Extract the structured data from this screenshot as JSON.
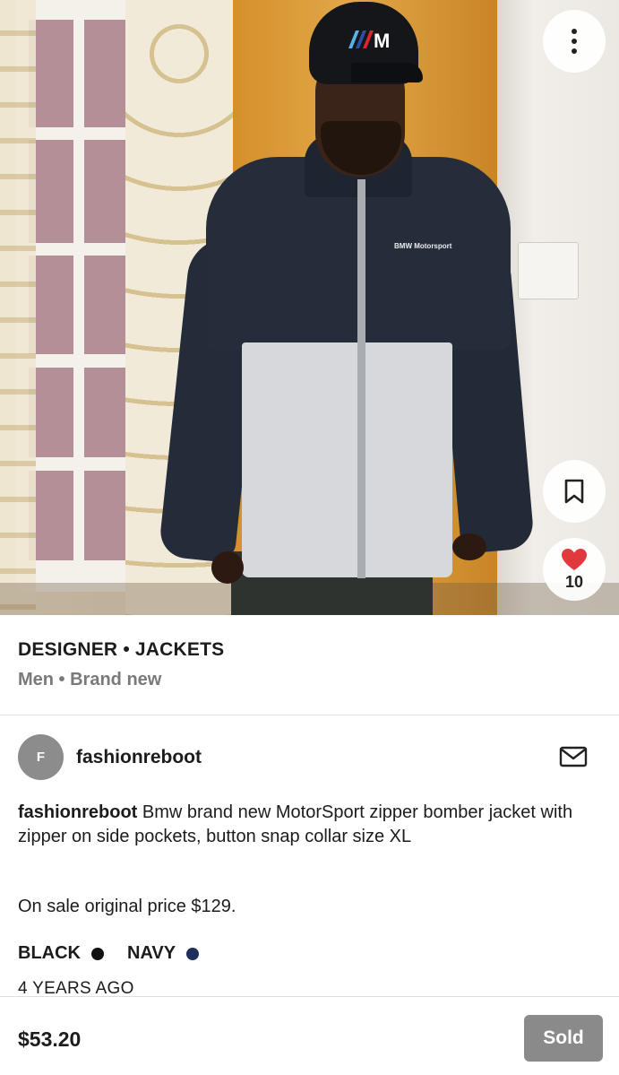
{
  "listing": {
    "photo_alt": "BMW Motorsport jacket",
    "chest_print": "BMW Motorsport",
    "like_count": "10",
    "category_line": "DESIGNER • JACKETS",
    "meta_line": "Men • Brand new"
  },
  "seller": {
    "avatar_initial": "F",
    "username": "fashionreboot"
  },
  "description": {
    "author": "fashionreboot",
    "text": " Bmw brand new MotorSport zipper bomber jacket with zipper on side pockets, button snap collar size XL",
    "sale_note": "On sale original price $129."
  },
  "colors": [
    {
      "label": "BLACK",
      "hex": "#111111"
    },
    {
      "label": "NAVY",
      "hex": "#1f2d5c"
    }
  ],
  "timestamp": "4 YEARS AGO",
  "footer": {
    "price": "$53.20",
    "status_label": "Sold"
  },
  "icons": {
    "more": "more-vertical-icon",
    "bookmark": "bookmark-icon",
    "heart": "heart-icon",
    "mail": "mail-icon"
  },
  "theme": {
    "heart_color": "#e0393e",
    "sold_button_color": "#8a8a8a"
  }
}
